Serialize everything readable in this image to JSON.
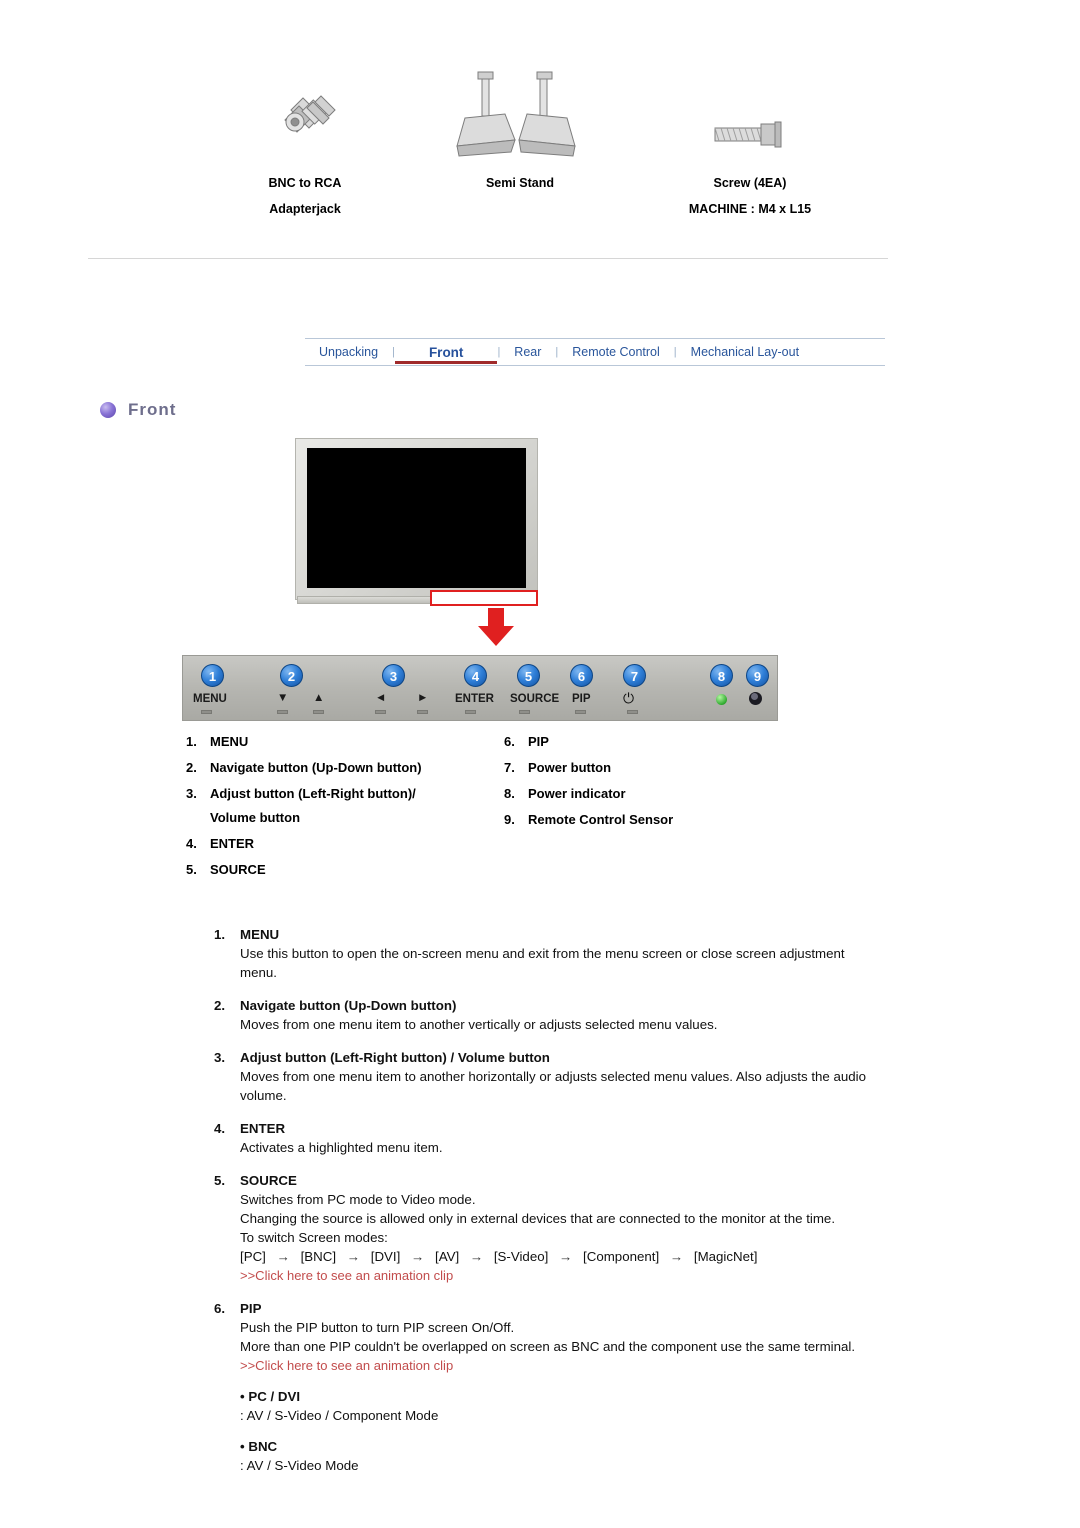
{
  "accessories": [
    {
      "icon": "bnc-to-rca-adapter-icon",
      "line1": "BNC to RCA",
      "line2": "Adapterjack"
    },
    {
      "icon": "semi-stand-icon",
      "line1": "Semi Stand",
      "line2": ""
    },
    {
      "icon": "screw-icon",
      "line1": "Screw (4EA)",
      "line2": "MACHINE : M4 x L15"
    }
  ],
  "tabs": [
    {
      "label": "Unpacking",
      "active": false
    },
    {
      "label": "Front",
      "active": true
    },
    {
      "label": "Rear",
      "active": false
    },
    {
      "label": "Remote Control",
      "active": false
    },
    {
      "label": "Mechanical Lay-out",
      "active": false
    }
  ],
  "section": {
    "title": "Front"
  },
  "control_panel": {
    "badges": [
      "1",
      "2",
      "3",
      "4",
      "5",
      "6",
      "7",
      "8",
      "9"
    ],
    "labels": [
      "MENU",
      "ENTER",
      "SOURCE",
      "PIP"
    ],
    "glyphs": {
      "down": "▼",
      "up": "▲",
      "left": "◄",
      "right": "►",
      "power": "⏻"
    }
  },
  "legend": {
    "left": [
      {
        "num": "1.",
        "text": "MENU",
        "sub": ""
      },
      {
        "num": "2.",
        "text": "Navigate button (Up-Down button)",
        "sub": ""
      },
      {
        "num": "3.",
        "text": "Adjust button (Left-Right button)/",
        "sub": "Volume button"
      },
      {
        "num": "4.",
        "text": "ENTER",
        "sub": ""
      },
      {
        "num": "5.",
        "text": "SOURCE",
        "sub": ""
      }
    ],
    "right": [
      {
        "num": "6.",
        "text": "PIP",
        "sub": ""
      },
      {
        "num": "7.",
        "text": "Power button",
        "sub": ""
      },
      {
        "num": "8.",
        "text": "Power indicator",
        "sub": ""
      },
      {
        "num": "9.",
        "text": "Remote Control Sensor",
        "sub": ""
      }
    ]
  },
  "details": {
    "menu": {
      "num": "1.",
      "title": "MENU",
      "body": "Use this button to open the on-screen menu and exit from the menu screen or close screen adjustment menu."
    },
    "navigate": {
      "num": "2.",
      "title": "Navigate button (Up-Down button)",
      "body": "Moves from one menu item to another vertically or adjusts selected menu values."
    },
    "adjust": {
      "num": "3.",
      "title": "Adjust button (Left-Right button) / Volume button",
      "body": "Moves from one menu item to another horizontally or adjusts selected menu values. Also adjusts the audio volume."
    },
    "enter": {
      "num": "4.",
      "title": "ENTER",
      "body": "Activates a highlighted menu item."
    },
    "source": {
      "num": "5.",
      "title": "SOURCE",
      "body1": "Switches from PC mode to Video mode.",
      "body2": "Changing the source is allowed only in external devices that are connected to the monitor at the time.",
      "body3": "To switch Screen modes:",
      "modes": [
        "[PC]",
        "[BNC]",
        "[DVI]",
        "[AV]",
        "[S-Video]",
        "[Component]",
        "[MagicNet]"
      ],
      "arrow": "→",
      "link": ">>Click here to see an animation clip"
    },
    "pip": {
      "num": "6.",
      "title": "PIP",
      "body1": "Push the PIP button to turn PIP screen On/Off.",
      "body2": "More than one PIP couldn't be overlapped on screen as BNC and the component use the same terminal.",
      "link": ">>Click here to see an animation clip",
      "sub1_title": "• PC / DVI",
      "sub1_body": ": AV / S-Video / Component Mode",
      "sub2_title": "• BNC",
      "sub2_body": ": AV / S-Video Mode"
    }
  }
}
